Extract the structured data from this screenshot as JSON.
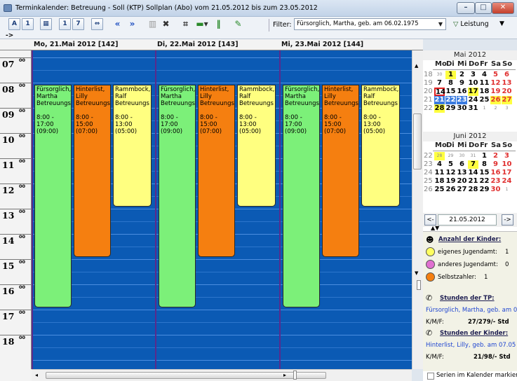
{
  "window": {
    "title": "Terminkalender: Betreuung - Soll (KTP) Sollplan (Abo) vom 21.05.2012 bis zum 23.05.2012",
    "buttons": {
      "minimize": "–",
      "maximize": "□",
      "close": "✕"
    }
  },
  "toolbar": {
    "buttons": [
      "A",
      "1",
      "▦",
      "1",
      "7",
      "⇔",
      "«",
      "»",
      "▥",
      "✖",
      "⌗",
      "▾",
      "‖",
      "✎"
    ],
    "filter_label": "Filter:",
    "filter_value": "Fürsorglich, Martha, geb. am 06.02.1975",
    "leistung_label": "Leistung",
    "expand": "->"
  },
  "schedule": {
    "hours": [
      "07",
      "08",
      "09",
      "10",
      "11",
      "12",
      "13",
      "14",
      "15",
      "16",
      "17",
      "18"
    ],
    "minute_label": "00",
    "days": [
      {
        "header": "Mo, 21.Mai 2012 [142]"
      },
      {
        "header": "Di, 22.Mai 2012 [143]"
      },
      {
        "header": "Mi, 23.Mai 2012 [144]"
      }
    ],
    "events": [
      {
        "name": "Fürsorglich,",
        "name2": "Martha",
        "type": "Betreuungs",
        "time": "8:00 -\n17:00\n(09:00)",
        "color": "green"
      },
      {
        "name": "Hinterlist,",
        "name2": "Lilly",
        "type": "Betreuungs",
        "time": "8:00 -\n15:00\n(07:00)",
        "color": "orange"
      },
      {
        "name": "Rammbock,",
        "name2": "Ralf",
        "type": "Betreuungs",
        "time": "8:00 -\n13:00\n(05:00)",
        "color": "yellow"
      }
    ]
  },
  "calendar_may": {
    "title": "Mai 2012",
    "weekdays": [
      "Mo",
      "Di",
      "Mi",
      "Do",
      "Fr",
      "Sa",
      "So"
    ],
    "weeks": [
      "18",
      "19",
      "20",
      "21",
      "22"
    ],
    "rows": [
      [
        "30",
        "1",
        "2",
        "3",
        "4",
        "5",
        "6"
      ],
      [
        "7",
        "8",
        "9",
        "10",
        "11",
        "12",
        "13"
      ],
      [
        "14",
        "15",
        "16",
        "17",
        "18",
        "19",
        "20"
      ],
      [
        "21",
        "22",
        "23",
        "24",
        "25",
        "26",
        "27"
      ],
      [
        "28",
        "29",
        "30",
        "31",
        "1",
        "2",
        "3"
      ]
    ]
  },
  "calendar_june": {
    "title": "Juni 2012",
    "weekdays": [
      "Mo",
      "Di",
      "Mi",
      "Do",
      "Fr",
      "Sa",
      "So"
    ],
    "weeks": [
      "22",
      "23",
      "24",
      "25",
      "26"
    ],
    "rows": [
      [
        "28",
        "29",
        "30",
        "31",
        "1",
        "2",
        "3"
      ],
      [
        "4",
        "5",
        "6",
        "7",
        "8",
        "9",
        "10"
      ],
      [
        "11",
        "12",
        "13",
        "14",
        "15",
        "16",
        "17"
      ],
      [
        "18",
        "19",
        "20",
        "21",
        "22",
        "23",
        "24"
      ],
      [
        "25",
        "26",
        "27",
        "28",
        "29",
        "30",
        "1"
      ]
    ]
  },
  "nav": {
    "prev": "<-",
    "date": "21.05.2012",
    "next": "->"
  },
  "info": {
    "kinder_title": "Anzahl der Kinder:",
    "eigenes": "eigenes Jugendamt:",
    "eigenes_val": "1",
    "anderes": "anderes Jugendamt:",
    "anderes_val": "0",
    "selbst": "Selbstzahler:",
    "selbst_val": "1",
    "tp_title": "Stunden der TP:",
    "tp_person": "Fürsorglich, Martha, geb. am 0",
    "tp_label": "K/M/F:",
    "tp_val": "27/279/- Std",
    "k_title": "Stunden der Kinder:",
    "k_person": "Hinterlist, Lilly, geb. am 07.05",
    "k_label": "K/M/F:",
    "k_val": "21/98/- Std"
  },
  "footer": {
    "serien": "Serien im Kalender markiere"
  }
}
